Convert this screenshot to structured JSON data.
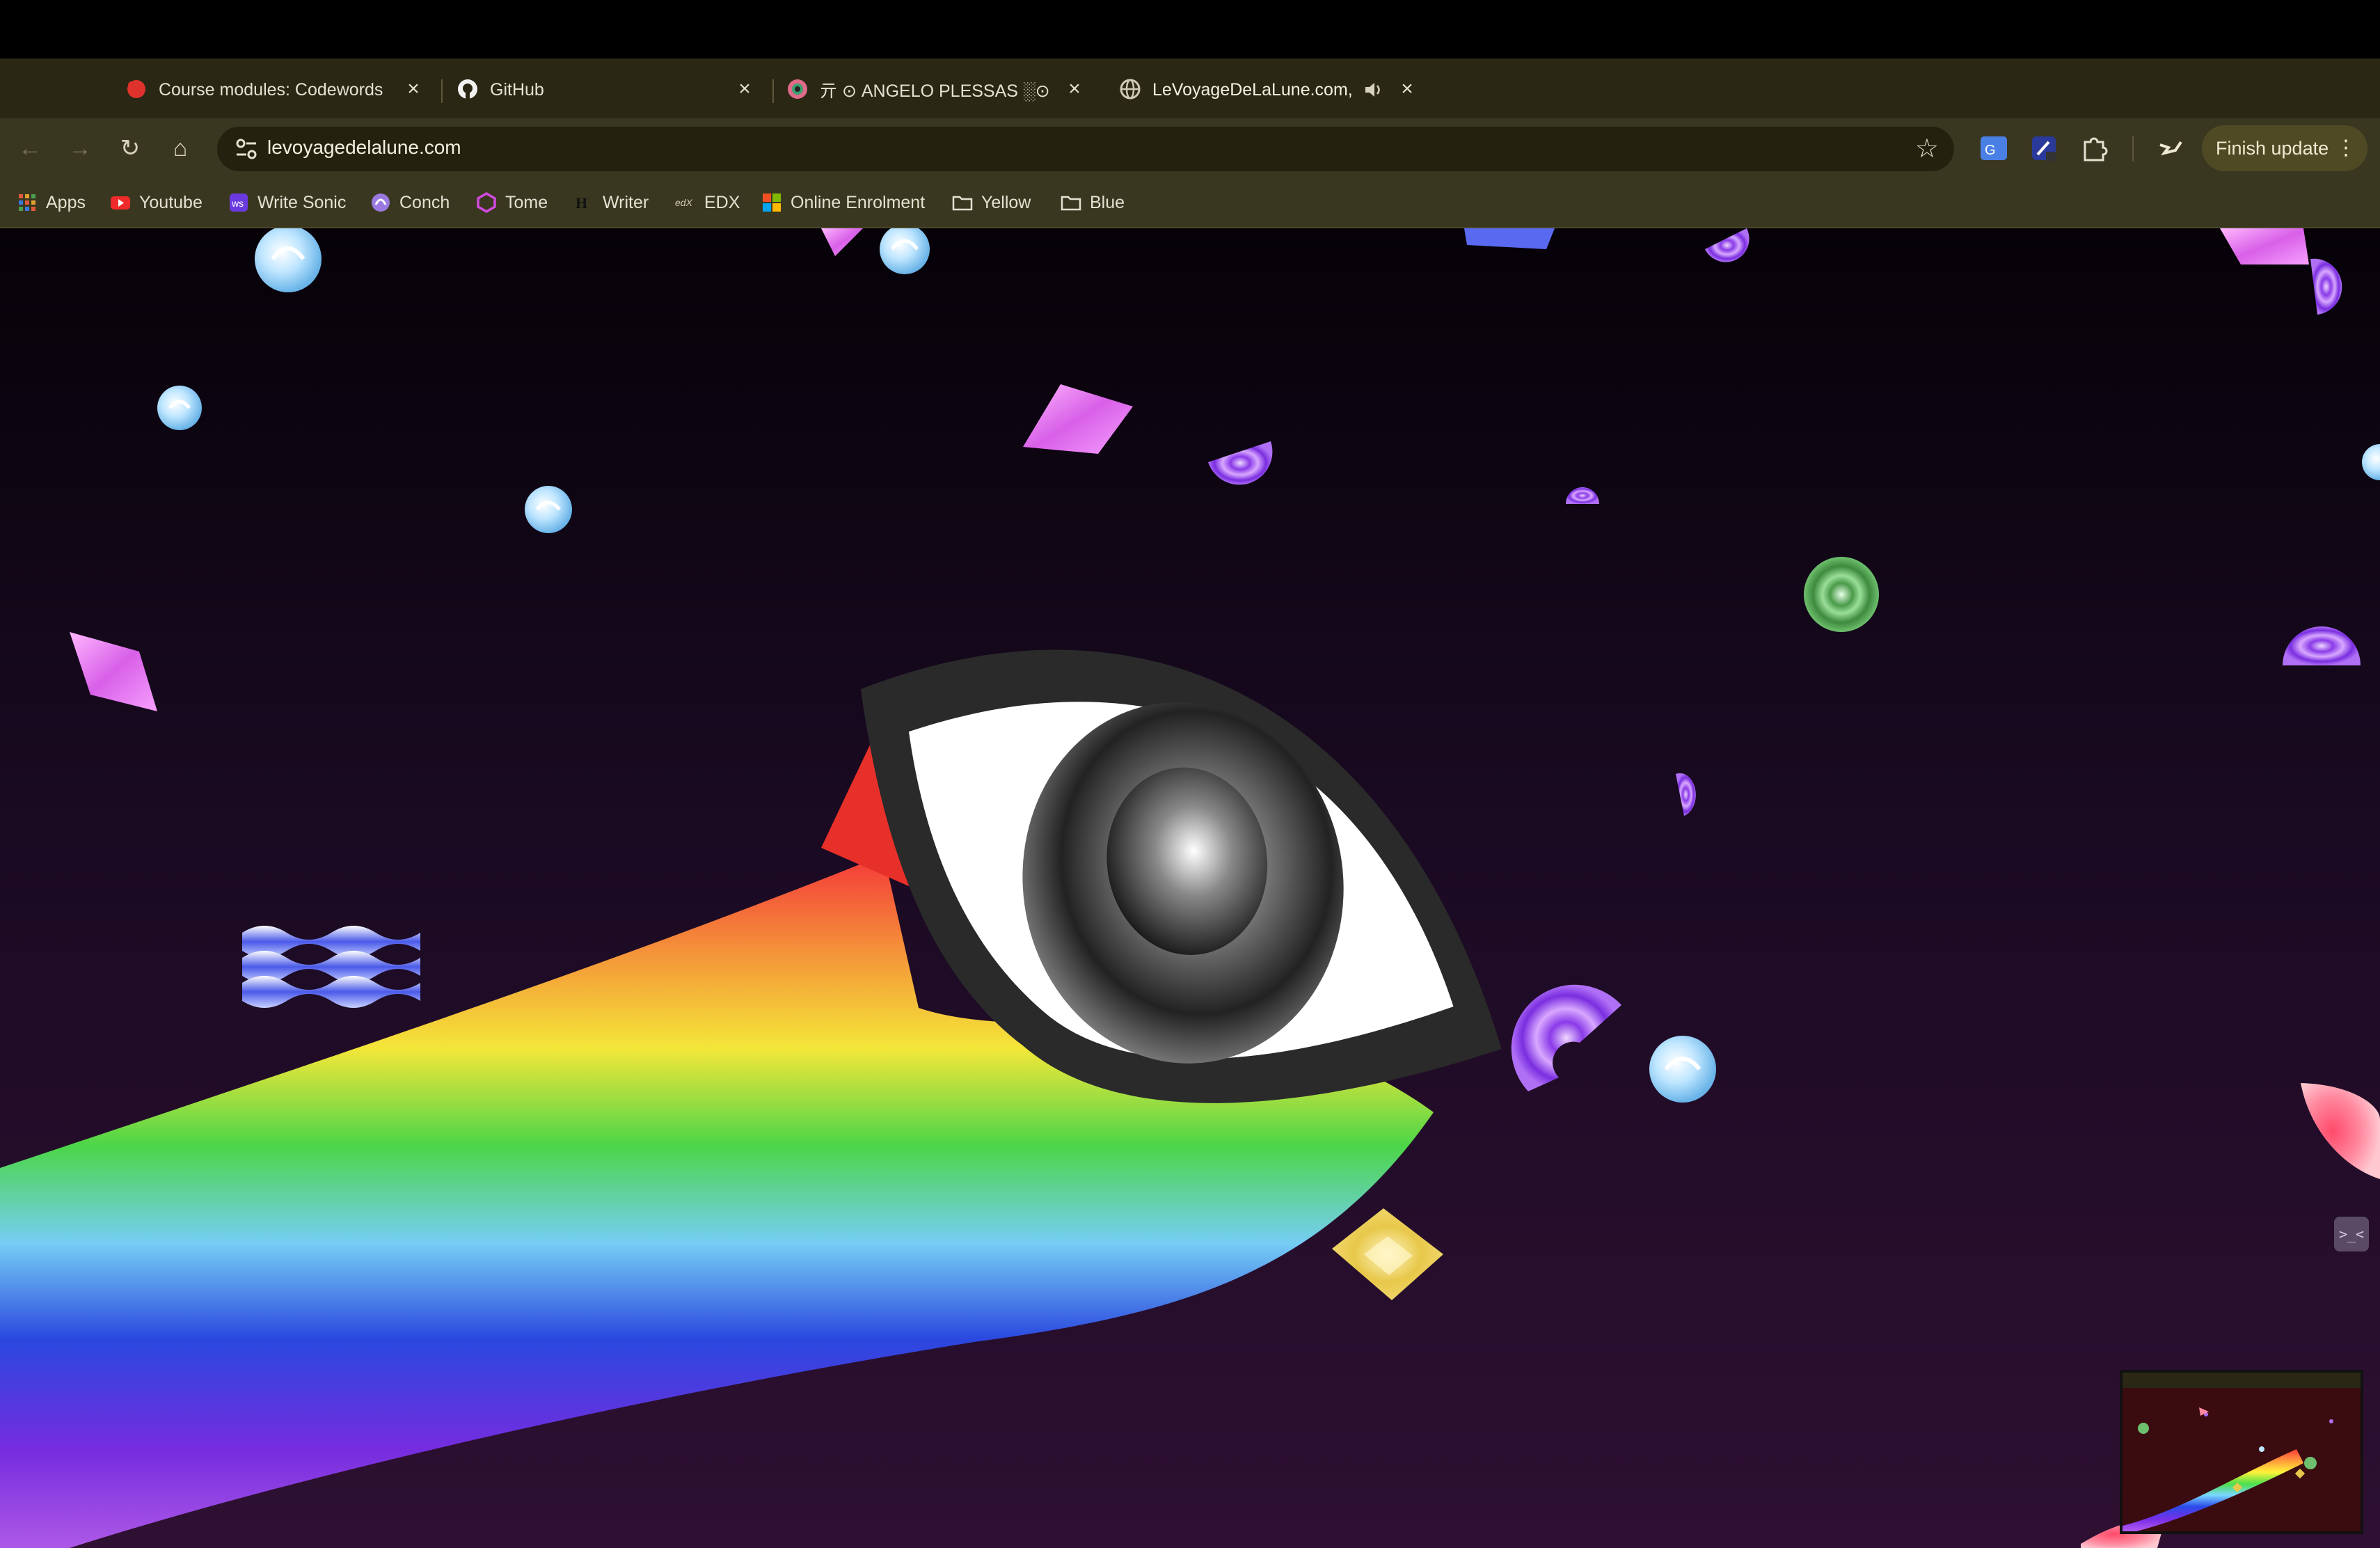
{
  "tabs": [
    {
      "title": "Course modules: Codewords",
      "favicon": "red-blob-icon",
      "active": false
    },
    {
      "title": "GitHub",
      "favicon": "github-icon",
      "active": false
    },
    {
      "title": "亓 ⊙ ANGELO PLESSAS ░⊙<",
      "favicon": "eye-favicon-icon",
      "active": false
    },
    {
      "title": "LeVoyageDeLaLune.com,",
      "favicon": "globe-icon",
      "active": true,
      "audio": "speaker-icon"
    }
  ],
  "new_tab_label": "+",
  "tab_search_label": "⌄",
  "toolbar": {
    "url": "levoyagedelalune.com",
    "finish_update_label": "Finish update",
    "menu_label": "⋮"
  },
  "bookmarks": [
    {
      "label": "Apps",
      "icon": "apps-grid-icon"
    },
    {
      "label": "Youtube",
      "icon": "youtube-icon"
    },
    {
      "label": "Write Sonic",
      "icon": "writesonic-icon"
    },
    {
      "label": "Conch",
      "icon": "conch-icon"
    },
    {
      "label": "Tome",
      "icon": "tome-icon"
    },
    {
      "label": "Writer",
      "icon": "writer-icon"
    },
    {
      "label": "EDX",
      "icon": "edx-icon"
    },
    {
      "label": "Online Enrolment",
      "icon": "microsoft-icon"
    },
    {
      "label": "Yellow",
      "icon": "folder-icon"
    },
    {
      "label": "Blue",
      "icon": "folder-icon"
    }
  ],
  "colors": {
    "chrome_bg": "#2a2715",
    "toolbar_bg": "#3a3720",
    "page_bg": "#1a0a22",
    "accent_update": "#504a24"
  },
  "page": {
    "terminal_button_label": ">_<"
  }
}
